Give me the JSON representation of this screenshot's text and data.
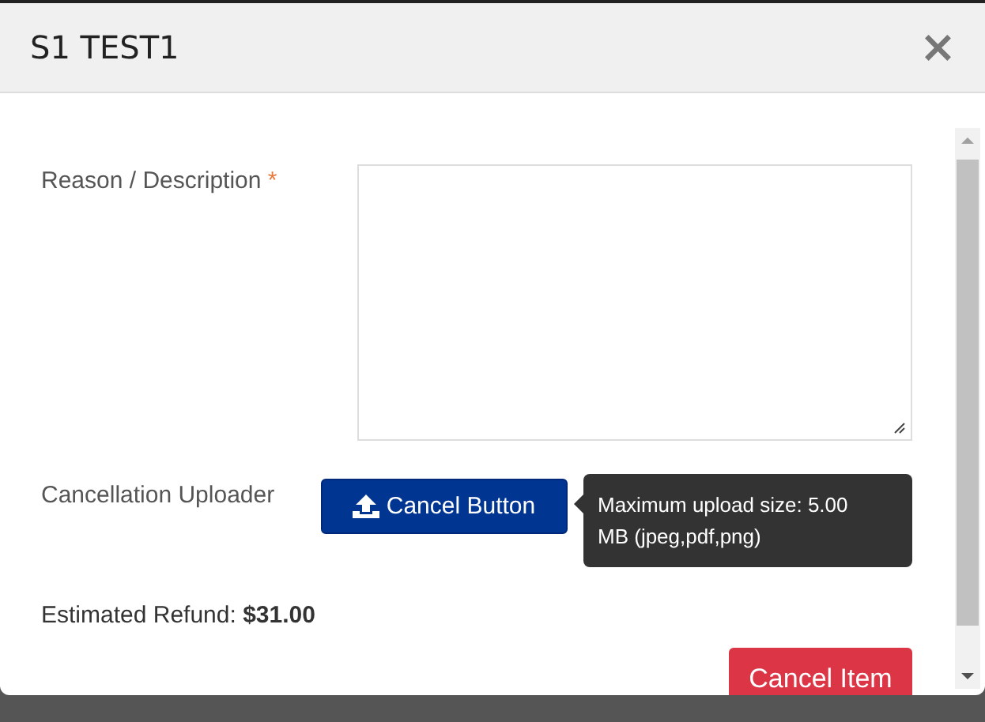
{
  "dialog": {
    "title": "S1 TEST1",
    "close": "×"
  },
  "reason": {
    "label": "Reason / Description",
    "required_mark": "*"
  },
  "uploader": {
    "label": "Cancellation Uploader",
    "button": "Cancel Button",
    "tooltip": "Maximum upload size: 5.00 MB (jpeg,pdf,png)"
  },
  "refund": {
    "label": "Estimated Refund:",
    "amount": "$31.00"
  },
  "submit": {
    "label": "Cancel Item"
  }
}
